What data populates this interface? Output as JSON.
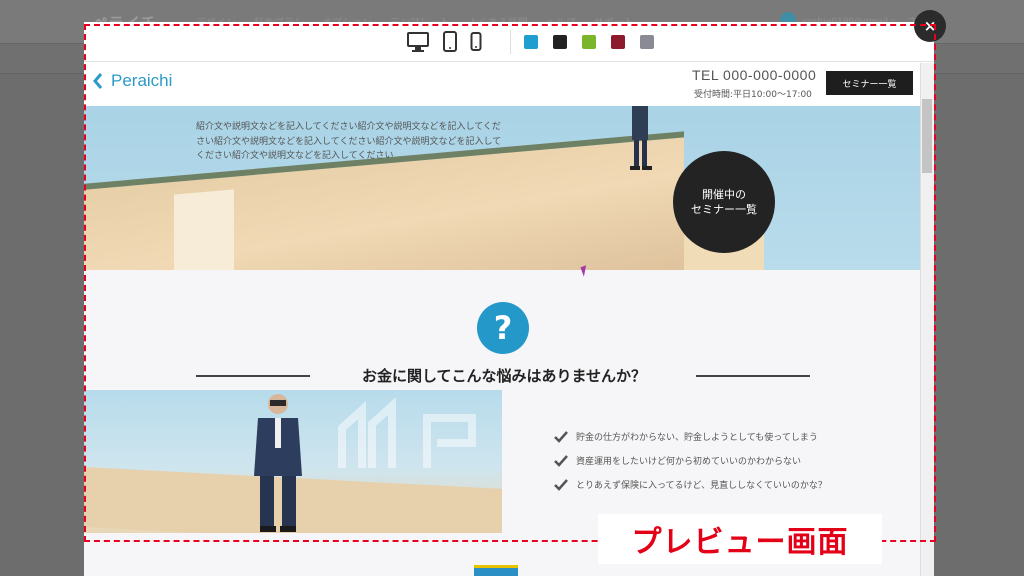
{
  "background": {
    "app_name": "ペライチ",
    "menu": [
      "デザイン",
      "料金プラン",
      "オプション",
      "テンプレート",
      "よくある質問",
      "ヘルプ",
      "サポート"
    ],
    "user": "yoshie0199@gmail.c... さん"
  },
  "toolbar": {
    "devices": [
      "desktop-icon",
      "tablet-icon",
      "mobile-icon"
    ],
    "colors": [
      "#1e9fd0",
      "#222222",
      "#7bb52a",
      "#8c1b2e",
      "#8a8a94"
    ],
    "close_label": "×"
  },
  "site": {
    "logo": "Peraichi",
    "tel": "TEL 000-000-0000",
    "hours": "受付時間:平日10:00〜17:00",
    "header_button": "セミナー一覧",
    "hero_text": "紹介文や説明文などを記入してください紹介文や説明文などを記入してください紹介文や説明文などを記入してください紹介文や説明文などを記入してください紹介文や説明文などを記入してください",
    "circle_line1": "開催中の",
    "circle_line2": "セミナー一覧",
    "question_mark": "?",
    "section_title": "お金に関してこんな悩みはありませんか？",
    "concerns": [
      "貯金の仕方がわからない、貯金しようとしても使ってしまう",
      "資産運用をしたいけど何から初めていいのかわからない",
      "とりあえず保険に入ってるけど、見直ししなくていいのかな？"
    ]
  },
  "annotation": {
    "label": "プレビュー画面",
    "color": "#e40016"
  }
}
